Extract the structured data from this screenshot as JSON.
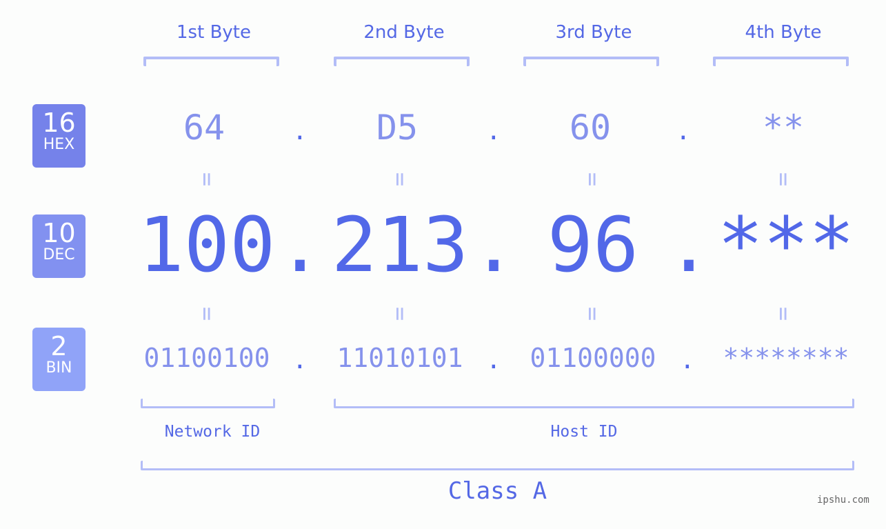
{
  "headers": [
    "1st Byte",
    "2nd Byte",
    "3rd Byte",
    "4th Byte"
  ],
  "badges": [
    {
      "num": "16",
      "label": "HEX",
      "color": "#7582ea"
    },
    {
      "num": "10",
      "label": "DEC",
      "color": "#8291f0"
    },
    {
      "num": "2",
      "label": "BIN",
      "color": "#90a3f8"
    }
  ],
  "hex": [
    "64",
    "D5",
    "60",
    "**"
  ],
  "dec": [
    "100",
    "213",
    "96",
    "***"
  ],
  "bin": [
    "01100100",
    "11010101",
    "01100000",
    "********"
  ],
  "separator": ".",
  "equals": "=",
  "network_id_label": "Network ID",
  "host_id_label": "Host ID",
  "class_label": "Class A",
  "watermark": "ipshu.com",
  "colors": {
    "accent": "#5268e8",
    "light": "#8592ec",
    "bracket": "#b3bdf7"
  }
}
